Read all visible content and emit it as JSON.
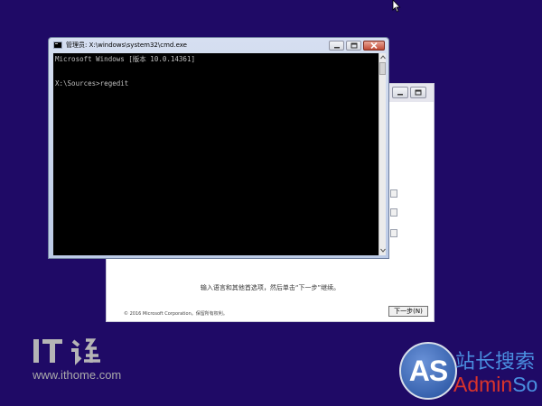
{
  "cmd_window": {
    "title": "管理员: X:\\windows\\system32\\cmd.exe",
    "lines": [
      "Microsoft Windows [版本 10.0.14361]",
      "",
      "X:\\Sources>regedit"
    ]
  },
  "setup_window": {
    "instruction": "输入语言和其他首选项，然后单击“下一步”继续。",
    "copyright": "© 2016 Microsoft Corporation。保留所有权利。",
    "next_button": "下一步(N)"
  },
  "watermarks": {
    "ithome_url": "www.ithome.com",
    "adminso_mark": "AS",
    "adminso_site_name": "站长搜索",
    "adminso_brand_prefix": "Admin",
    "adminso_brand_suffix": "So"
  },
  "colors": {
    "desktop_background": "#1f0a66",
    "console_background": "#000000",
    "console_text": "#c0c0c0",
    "adminso_blue": "#4a8fe0",
    "adminso_red": "#d9342b"
  },
  "icons": [
    "cursor-arrow-icon",
    "cmd-app-icon",
    "minimize-icon",
    "maximize-icon",
    "close-icon",
    "scroll-up-icon",
    "scroll-down-icon",
    "ithome-logo-icon",
    "adminso-logo-icon"
  ]
}
